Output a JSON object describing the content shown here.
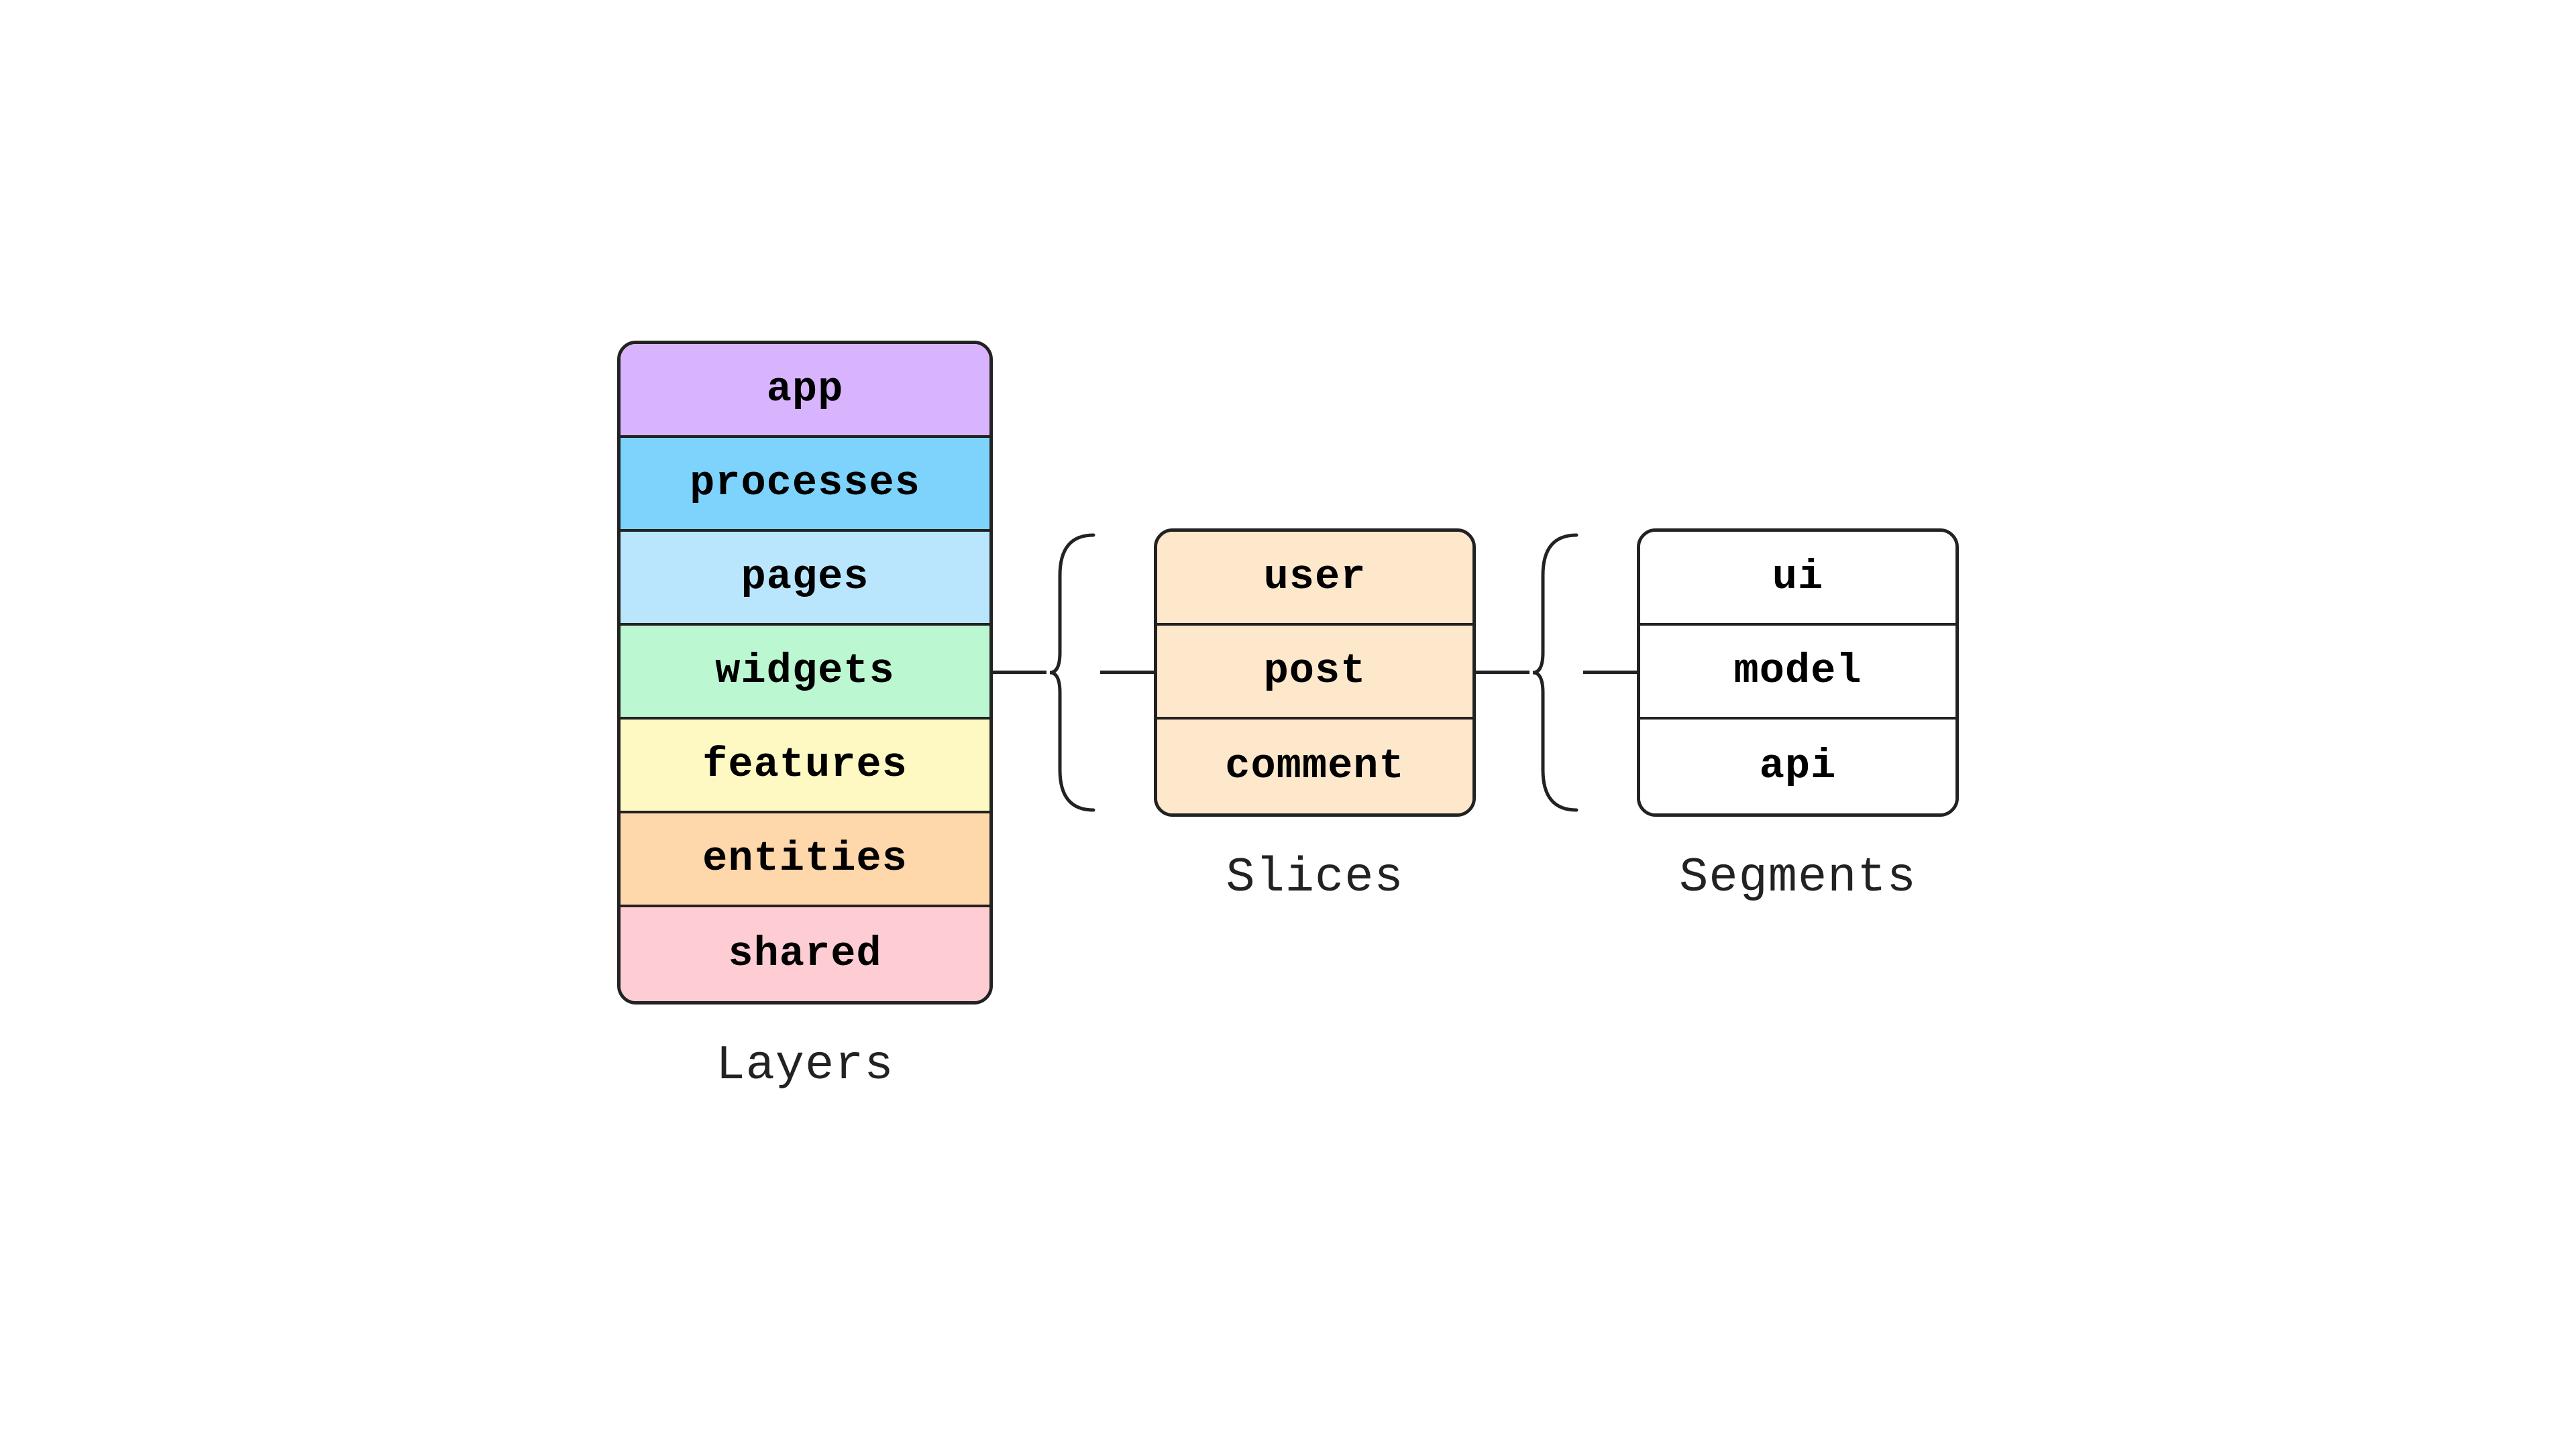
{
  "layers": {
    "label": "Layers",
    "items": [
      {
        "name": "app",
        "class": "layer-app"
      },
      {
        "name": "processes",
        "class": "layer-processes"
      },
      {
        "name": "pages",
        "class": "layer-pages"
      },
      {
        "name": "widgets",
        "class": "layer-widgets"
      },
      {
        "name": "features",
        "class": "layer-features"
      },
      {
        "name": "entities",
        "class": "layer-entities"
      },
      {
        "name": "shared",
        "class": "layer-shared"
      }
    ]
  },
  "slices": {
    "label": "Slices",
    "items": [
      {
        "name": "user"
      },
      {
        "name": "post"
      },
      {
        "name": "comment"
      }
    ]
  },
  "segments": {
    "label": "Segments",
    "items": [
      {
        "name": "ui"
      },
      {
        "name": "model"
      },
      {
        "name": "api"
      }
    ]
  },
  "connector_line_width": 120,
  "brace_height": 420,
  "brace_width": 80
}
